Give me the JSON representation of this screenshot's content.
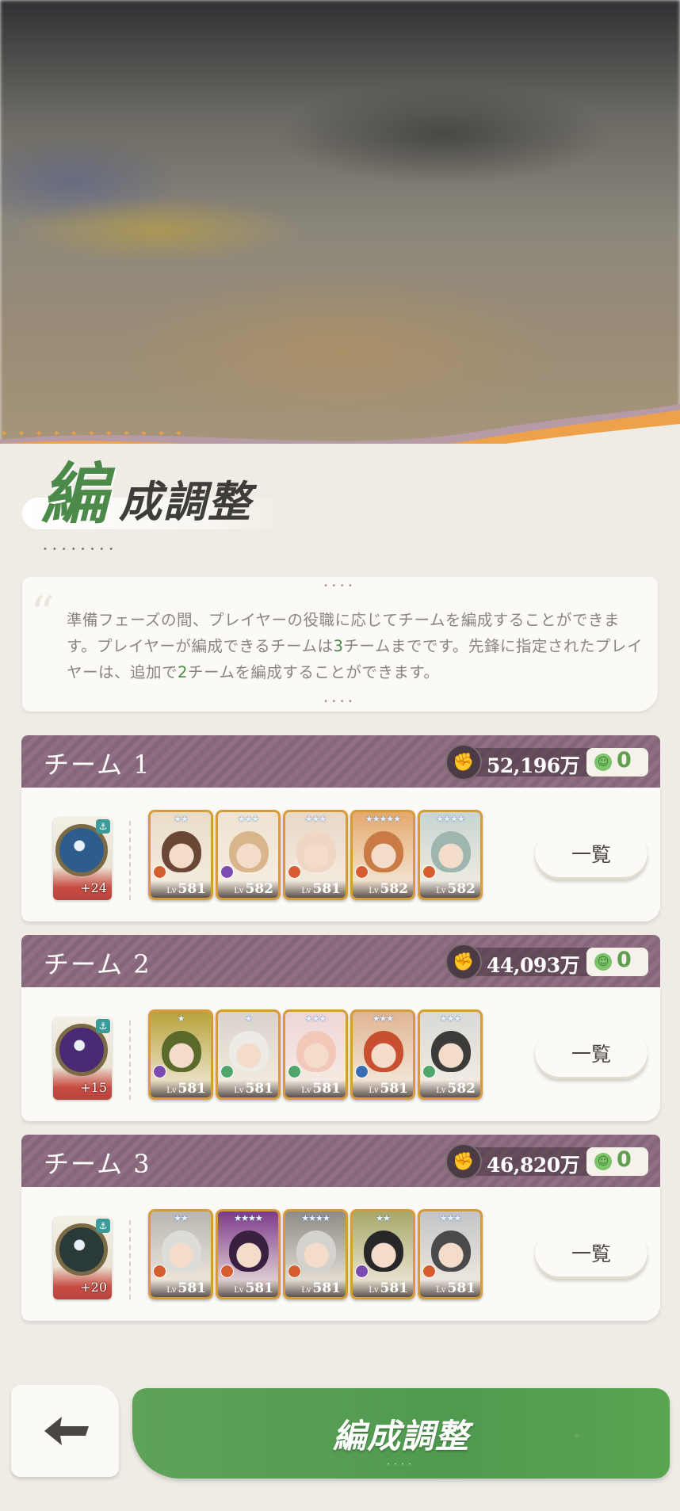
{
  "title": {
    "first_char": "編",
    "rest": "成調整"
  },
  "info": {
    "parts": [
      "準備フェーズの間、プレイヤーの役職に応じてチームを編成することができます。プレイヤーが編成できるチームは",
      "3",
      "チームまでです。先鋒に指定されたプレイヤーは、追加で",
      "2",
      "チームを編成することができます。"
    ]
  },
  "teams": [
    {
      "name": "チーム 1",
      "power": "52,196万",
      "mood": "0",
      "relic_plus": "+24",
      "relic_color": "#2e5c8c",
      "heroes": [
        {
          "level": "581",
          "lv_label": "Lv",
          "stars": "★★",
          "face": "#6a4634",
          "bg": "#e9dcc8",
          "elem": "#d65d2f"
        },
        {
          "level": "582",
          "lv_label": "Lv",
          "stars": "★★★",
          "face": "#d8b58a",
          "bg": "#efe4d2",
          "elem": "#7a4bb0"
        },
        {
          "level": "581",
          "lv_label": "Lv",
          "stars": "★★★",
          "face": "#f0d7c4",
          "bg": "#e8d8c7",
          "elem": "#d65d2f"
        },
        {
          "level": "582",
          "lv_label": "Lv",
          "stars": "★★★★★",
          "face": "#c97a45",
          "bg": "#e5a86e",
          "elem": "#d65d2f"
        },
        {
          "level": "582",
          "lv_label": "Lv",
          "stars": "★★★★",
          "face": "#9fb5b0",
          "bg": "#c7d5d0",
          "elem": "#d65d2f"
        }
      ],
      "list_label": "一覧"
    },
    {
      "name": "チーム 2",
      "power": "44,093万",
      "mood": "0",
      "relic_plus": "+15",
      "relic_color": "#4a2a74",
      "heroes": [
        {
          "level": "581",
          "lv_label": "Lv",
          "stars": "★",
          "face": "#5a6a2a",
          "bg": "#b8a23a",
          "elem": "#7a4bb0"
        },
        {
          "level": "581",
          "lv_label": "Lv",
          "stars": "★",
          "face": "#eeeae5",
          "bg": "#d9d3cc",
          "elem": "#4fa56a"
        },
        {
          "level": "581",
          "lv_label": "Lv",
          "stars": "★★★",
          "face": "#f2c9b8",
          "bg": "#efd6d8",
          "elem": "#4fa56a"
        },
        {
          "level": "581",
          "lv_label": "Lv",
          "stars": "★★★",
          "face": "#c84f2f",
          "bg": "#e0b592",
          "elem": "#3b6fb5"
        },
        {
          "level": "582",
          "lv_label": "Lv",
          "stars": "★★★",
          "face": "#3b3c3a",
          "bg": "#d9d9d6",
          "elem": "#4fa56a"
        }
      ],
      "list_label": "一覧"
    },
    {
      "name": "チーム 3",
      "power": "46,820万",
      "mood": "0",
      "relic_plus": "+20",
      "relic_color": "#2a3a3a",
      "heroes": [
        {
          "level": "581",
          "lv_label": "Lv",
          "stars": "★★",
          "face": "#dcdcd8",
          "bg": "#b9b6b1",
          "elem": "#d65d2f"
        },
        {
          "level": "581",
          "lv_label": "Lv",
          "stars": "★★★★",
          "face": "#3a2040",
          "bg": "#7d3b8a",
          "elem": "#d65d2f"
        },
        {
          "level": "581",
          "lv_label": "Lv",
          "stars": "★★★★",
          "face": "#d3d2cc",
          "bg": "#8e8c86",
          "elem": "#d65d2f"
        },
        {
          "level": "581",
          "lv_label": "Lv",
          "stars": "★★",
          "face": "#27272a",
          "bg": "#a6a86a",
          "elem": "#7a4bb0"
        },
        {
          "level": "581",
          "lv_label": "Lv",
          "stars": "★★★",
          "face": "#4b4a4a",
          "bg": "#c2c4c6",
          "elem": "#d65d2f"
        }
      ],
      "list_label": "一覧"
    }
  ],
  "bottom": {
    "confirm_label": "編成調整",
    "back_icon": "back-arrow-icon"
  },
  "colors": {
    "accent_green": "#4c8a4a",
    "team_header": "#8b6b7d",
    "frame_gold": "#d79b3a"
  }
}
